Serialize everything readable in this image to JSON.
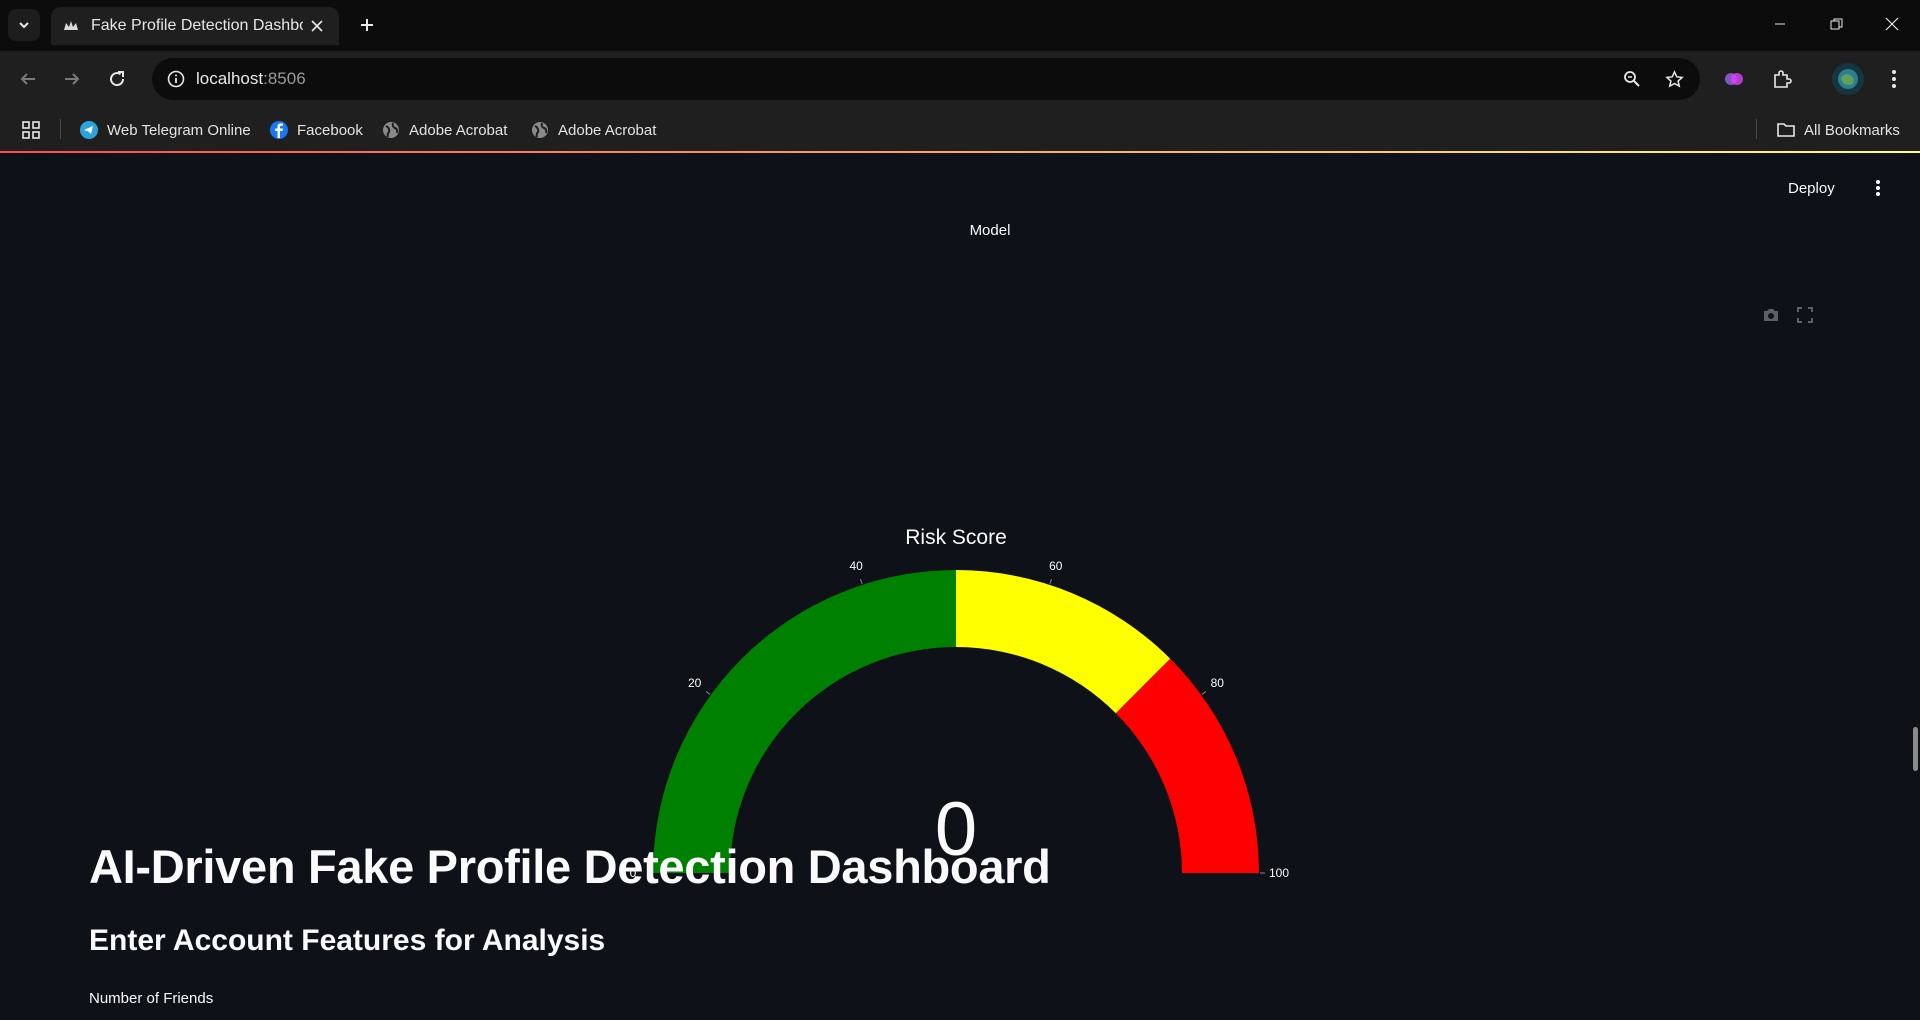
{
  "browser": {
    "tab_title": "Fake Profile Detection Dashboard",
    "url_host": "localhost",
    "url_port": ":8506",
    "bookmarks": [
      {
        "label": "Web Telegram Online",
        "icon": "telegram-icon"
      },
      {
        "label": "Facebook",
        "icon": "facebook-icon"
      },
      {
        "label": "Adobe Acrobat",
        "icon": "globe-icon"
      },
      {
        "label": "Adobe Acrobat",
        "icon": "globe-icon"
      }
    ],
    "all_bookmarks": "All Bookmarks"
  },
  "app": {
    "deploy_label": "Deploy",
    "model_label": "Model",
    "title": "AI-Driven Fake Profile Detection Dashboard",
    "subheader": "Enter Account Features for Analysis",
    "field_label": "Number of Friends"
  },
  "chart_data": {
    "type": "gauge",
    "title": "Risk Score",
    "value": 0,
    "range": [
      0,
      100
    ],
    "ticks": [
      0,
      20,
      40,
      60,
      80,
      100
    ],
    "bands": [
      {
        "from": 0,
        "to": 50,
        "color": "#008000"
      },
      {
        "from": 50,
        "to": 75,
        "color": "#ffff00"
      },
      {
        "from": 75,
        "to": 100,
        "color": "#ff0000"
      }
    ]
  }
}
